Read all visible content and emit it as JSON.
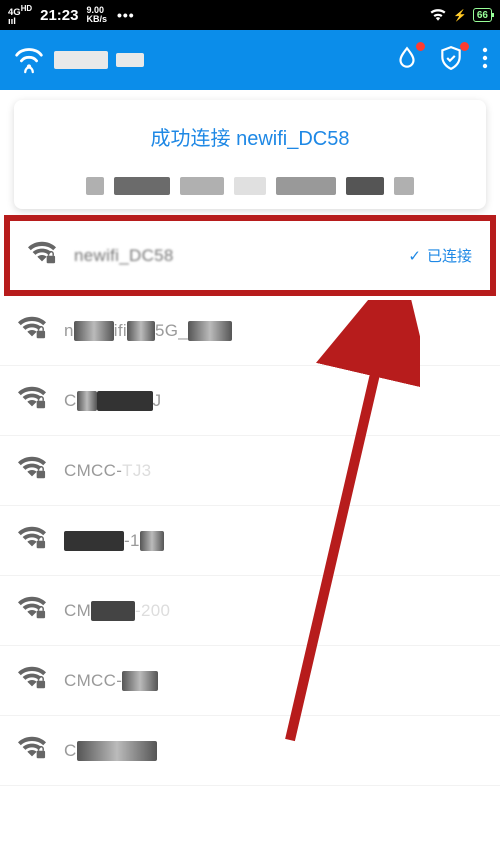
{
  "status_bar": {
    "network_label": "4G",
    "network_sub": "HD",
    "time": "21:23",
    "speed_value": "9.00",
    "speed_unit": "KB/s",
    "wifi": true,
    "charging": true,
    "battery_percent": "66"
  },
  "header": {
    "icons": {
      "drop": "water-drop-icon",
      "shield": "shield-check-icon",
      "menu": "more-vertical-icon"
    }
  },
  "banner": {
    "title": "成功连接 newifi_DC58"
  },
  "wifi": {
    "connected_label": "已连接",
    "items": [
      {
        "name": "newifi_DC58",
        "connected": true,
        "locked": true
      },
      {
        "name": "newifi5G_DC58",
        "connected": false,
        "locked": true
      },
      {
        "name": "CU_MJ",
        "connected": false,
        "locked": true
      },
      {
        "name": "CMCC-TJ3",
        "connected": false,
        "locked": true
      },
      {
        "name": "CMCC-108",
        "connected": false,
        "locked": true
      },
      {
        "name": "CMCC-200",
        "connected": false,
        "locked": true
      },
      {
        "name": "CMCC-000",
        "connected": false,
        "locked": true
      },
      {
        "name": "CMCC-D",
        "connected": false,
        "locked": true
      }
    ]
  }
}
